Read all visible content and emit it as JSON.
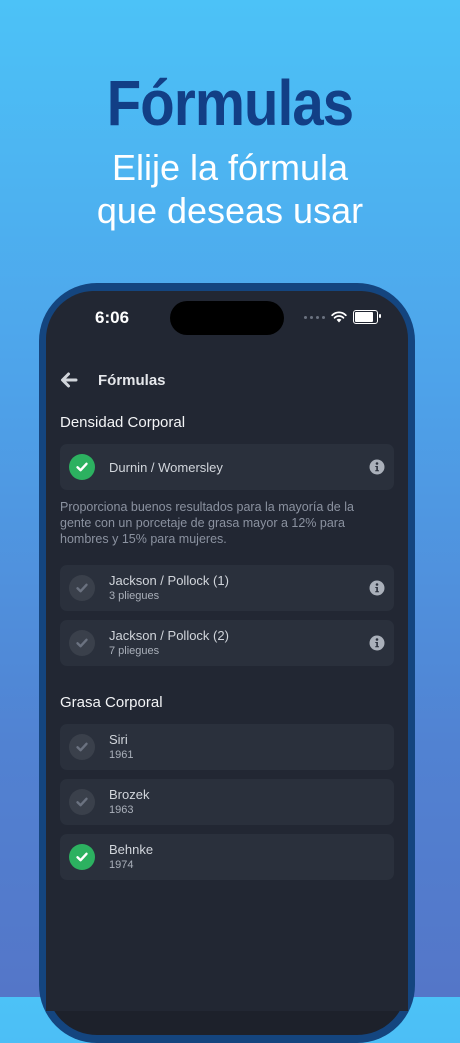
{
  "hero": {
    "title": "Fórmulas",
    "subtitle_line1": "Elije la fórmula",
    "subtitle_line2": "que deseas usar"
  },
  "status_bar": {
    "time": "6:06"
  },
  "nav": {
    "title": "Fórmulas",
    "back_icon": "arrow-left-icon"
  },
  "density": {
    "section_title": "Densidad Corporal",
    "selected": {
      "title": "Durnin / Womersley",
      "checked": true,
      "description": "Proporciona buenos resultados para la mayoría de la gente con un porcetaje de grasa mayor a 12% para hombres y 15% para mujeres."
    },
    "options": [
      {
        "title": "Jackson / Pollock (1)",
        "subtitle": "3 pliegues",
        "checked": false
      },
      {
        "title": "Jackson / Pollock (2)",
        "subtitle": "7 pliegues",
        "checked": false
      }
    ]
  },
  "fat": {
    "section_title": "Grasa Corporal",
    "options": [
      {
        "title": "Siri",
        "subtitle": "1961",
        "checked": false
      },
      {
        "title": "Brozek",
        "subtitle": "1963",
        "checked": false
      },
      {
        "title": "Behnke",
        "subtitle": "1974",
        "checked": true
      }
    ]
  },
  "colors": {
    "checked": "#2cb160",
    "unchecked": "#3a404b",
    "card": "#2a303c",
    "background": "#222733"
  }
}
